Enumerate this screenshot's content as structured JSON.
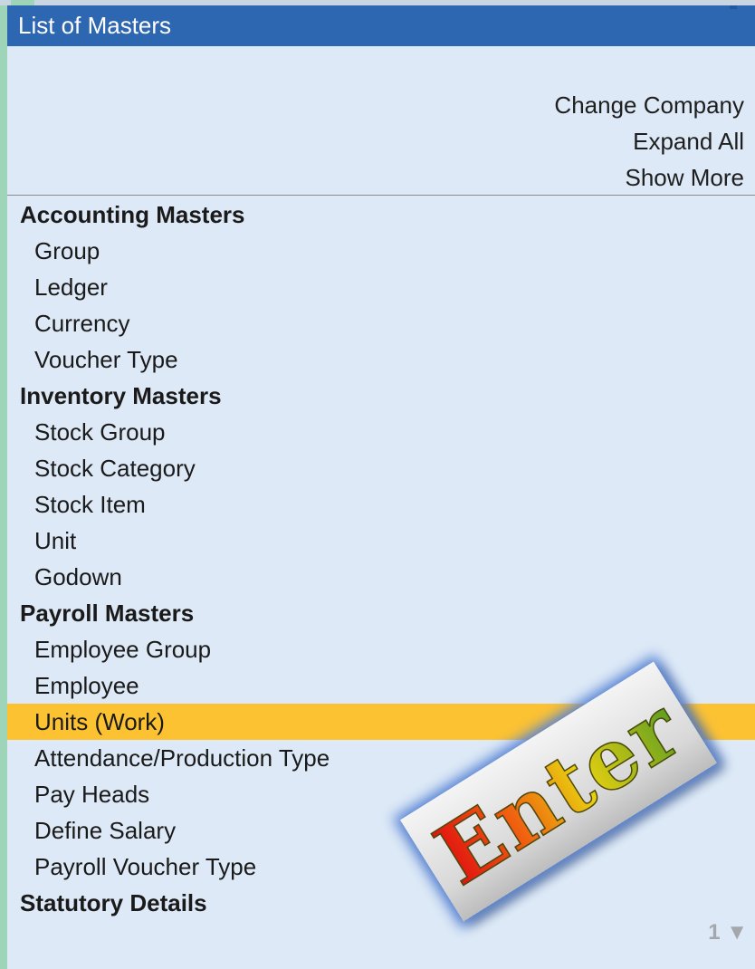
{
  "window": {
    "title": "List of Masters"
  },
  "actions": [
    {
      "label": "Change Company"
    },
    {
      "label": "Expand All"
    },
    {
      "label": "Show More"
    }
  ],
  "groups": [
    {
      "heading": "Accounting Masters",
      "items": [
        "Group",
        "Ledger",
        "Currency",
        "Voucher Type"
      ]
    },
    {
      "heading": "Inventory Masters",
      "items": [
        "Stock Group",
        "Stock Category",
        "Stock Item",
        "Unit",
        "Godown"
      ]
    },
    {
      "heading": "Payroll Masters",
      "items": [
        "Employee Group",
        "Employee",
        "Units (Work)",
        "Attendance/Production Type",
        "Pay Heads",
        "Define Salary",
        "Payroll Voucher Type"
      ]
    },
    {
      "heading": "Statutory Details",
      "items": []
    }
  ],
  "selected_item": "Units (Work)",
  "page_indicator": "1 ▼",
  "badge": {
    "text": "Enter"
  },
  "colors": {
    "title_bar": "#2e67b1",
    "panel_background": "#dde9f6",
    "selection": "#fcc232",
    "outer_background": "#9ed4b8"
  }
}
